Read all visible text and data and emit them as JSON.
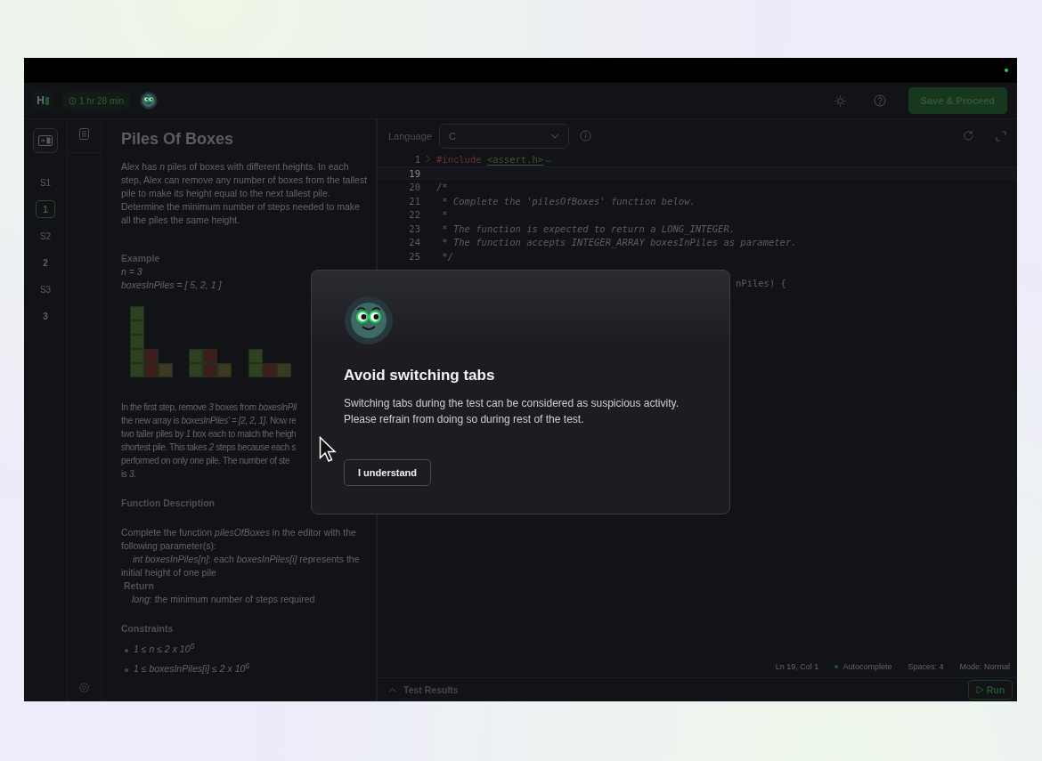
{
  "header": {
    "logo": "H",
    "timer": "1 hr 28 min",
    "save_button": "Save & Proceed"
  },
  "sidebar": {
    "sections": [
      {
        "label": "S1",
        "questions": [
          {
            "number": "1",
            "selected": true
          }
        ]
      },
      {
        "label": "S2",
        "questions": [
          {
            "number": "2",
            "selected": false
          }
        ]
      },
      {
        "label": "S3",
        "questions": [
          {
            "number": "3",
            "selected": false
          }
        ]
      }
    ]
  },
  "problem": {
    "title": "Piles Of Boxes",
    "intro": "Alex has *n* piles of boxes with different heights. In each step, Alex can remove any number of boxes from the tallest pile to make its height equal to the next tallest pile. Determine the minimum number of steps needed to make all the piles the same height.",
    "example": {
      "heading": "Example",
      "lines": [
        "n = 3",
        "boxesInPiles = [ 5, 2, 1 ]"
      ]
    },
    "explanation_lines": [
      "In the first step, remove *3* boxes from *boxesInPil*",
      "the new array is *boxesInPiles' = [2, 2, 1]*.  Now re",
      "two taller piles by *1* box each to match the heigh",
      "shortest pile.  This takes *2* steps because each s",
      "performed on only one pile.  The number of ste",
      "is *3*."
    ],
    "function_description": {
      "heading": "Function Description",
      "text": "Complete the function *pilesOfBoxes* in the editor with the following parameter(s):",
      "param": "*int boxesInPiles[n]*: each *boxesInPiles[i]* represents the initial height of one pile",
      "return_heading": "Return",
      "return_text": "*long*: the minimum number of steps required"
    },
    "constraints": {
      "heading": "Constraints",
      "items": [
        "1 ≤ n ≤ 2 x 10$^{5}$",
        "1 ≤ boxesInPiles[i] ≤ 2 x 10$^{6}$"
      ]
    }
  },
  "editor": {
    "language_label": "Language",
    "language": "C",
    "lines": [
      {
        "kind": "include",
        "number": "1",
        "directive": "#include",
        "header": "<assert.h>",
        "current": false
      },
      {
        "kind": "plain",
        "number": "19",
        "current": true
      },
      {
        "kind": "plain",
        "number": "20",
        "code": "/*",
        "current": false
      },
      {
        "kind": "plain",
        "number": "21",
        "code": " * Complete the 'pilesOfBoxes' function below.",
        "current": false
      },
      {
        "kind": "plain",
        "number": "22",
        "code": " *",
        "current": false
      },
      {
        "kind": "plain",
        "number": "23",
        "code": " * The function is expected to return a LONG_INTEGER.",
        "current": false
      },
      {
        "kind": "plain",
        "number": "24",
        "code": " * The function accepts INTEGER_ARRAY boxesInPiles as parameter.",
        "current": false
      },
      {
        "kind": "plain",
        "number": "25",
        "code": " */",
        "current": false
      },
      {
        "kind": "clipped",
        "code": "nPiles) {",
        "current": false
      }
    ],
    "status": {
      "position": "Ln 19, Col 1",
      "autocomplete": "Autocomplete",
      "spaces": "Spaces: 4",
      "mode": "Mode: Normal"
    },
    "test_results": "Test Results",
    "run_button": "Run"
  },
  "dialog": {
    "title": "Avoid switching tabs",
    "message_lines": [
      "Switching tabs during the test can be considered as suspicious activity.",
      "Please refrain from doing so during rest of the test."
    ],
    "button": "I understand"
  }
}
